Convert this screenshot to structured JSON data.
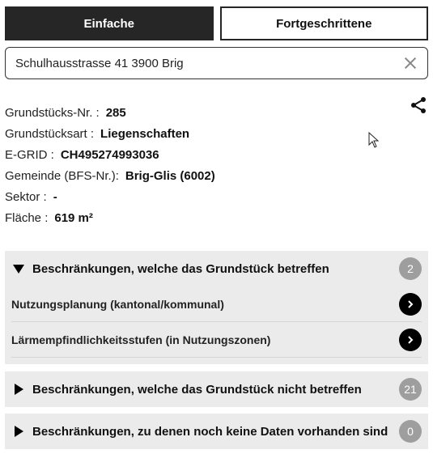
{
  "tabs": {
    "simple": "Einfache",
    "advanced": "Fortgeschrittene"
  },
  "search": {
    "value": "Schulhausstrasse 41 3900 Brig"
  },
  "parcel": [
    {
      "label": "Grundstücks-Nr. :",
      "value": "285"
    },
    {
      "label": "Grundstücksart :",
      "value": "Liegenschaften"
    },
    {
      "label": "E-GRID :",
      "value": "CH495274993036"
    },
    {
      "label": "Gemeinde (BFS-Nr.):",
      "value": "Brig-Glis (6002)"
    },
    {
      "label": "Sektor :",
      "value": "-"
    },
    {
      "label": "Fläche :",
      "value": "619 m²"
    }
  ],
  "sections": [
    {
      "title": "Beschränkungen, welche das Grundstück betreffen",
      "count": "2",
      "expanded": true,
      "items": [
        "Nutzungsplanung (kantonal/kommunal)",
        "Lärmempfindlichkeitsstufen (in Nutzungszonen)"
      ]
    },
    {
      "title": "Beschränkungen, welche das Grundstück nicht betreffen",
      "count": "21",
      "expanded": false
    },
    {
      "title": "Beschränkungen, zu denen noch keine Daten vorhanden sind",
      "count": "0",
      "expanded": false
    }
  ],
  "icons": {
    "share": "share-icon",
    "clear": "close-icon",
    "expand": "triangle-icon",
    "go": "chevron-right-icon"
  },
  "colors": {
    "dark": "#262626",
    "panel": "#ebebeb",
    "badge": "#9e9e9e"
  }
}
